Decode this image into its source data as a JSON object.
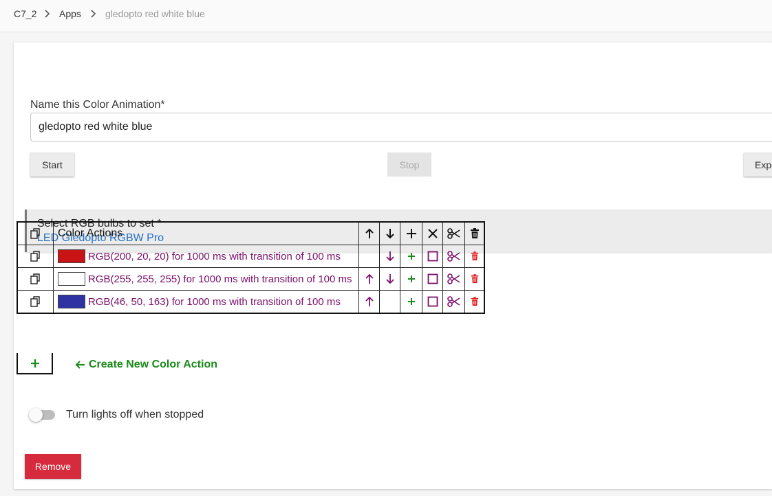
{
  "breadcrumb": {
    "items": [
      "C7_2",
      "Apps"
    ],
    "current": "gledopto red white blue"
  },
  "form": {
    "name_label": "Name this Color Animation*",
    "name_value": "gledopto red white blue",
    "start_label": "Start",
    "stop_label": "Stop",
    "export_label": "Expo"
  },
  "bulbs": {
    "title": "Select RGB bulbs to set *",
    "value": "LED Gledopto RGBW Pro"
  },
  "table": {
    "header": "Color Actions",
    "rows": [
      {
        "color": "#c81414",
        "text": "RGB(200, 20, 20) for 1000 ms with transition of 100 ms"
      },
      {
        "color": "#ffffff",
        "text": "RGB(255, 255, 255) for 1000 ms with transition of 100 ms"
      },
      {
        "color": "#2e32a3",
        "text": "RGB(46, 50, 163) for 1000 ms with transition of 100 ms"
      }
    ],
    "create_label": "Create New Color Action"
  },
  "toggle": {
    "label": "Turn lights off when stopped",
    "on": false
  },
  "remove_label": "Remove",
  "colors": {
    "purple": "#7b0f6b",
    "green": "#1a8a1a",
    "red": "#e02020",
    "link": "#1f6fc5"
  }
}
